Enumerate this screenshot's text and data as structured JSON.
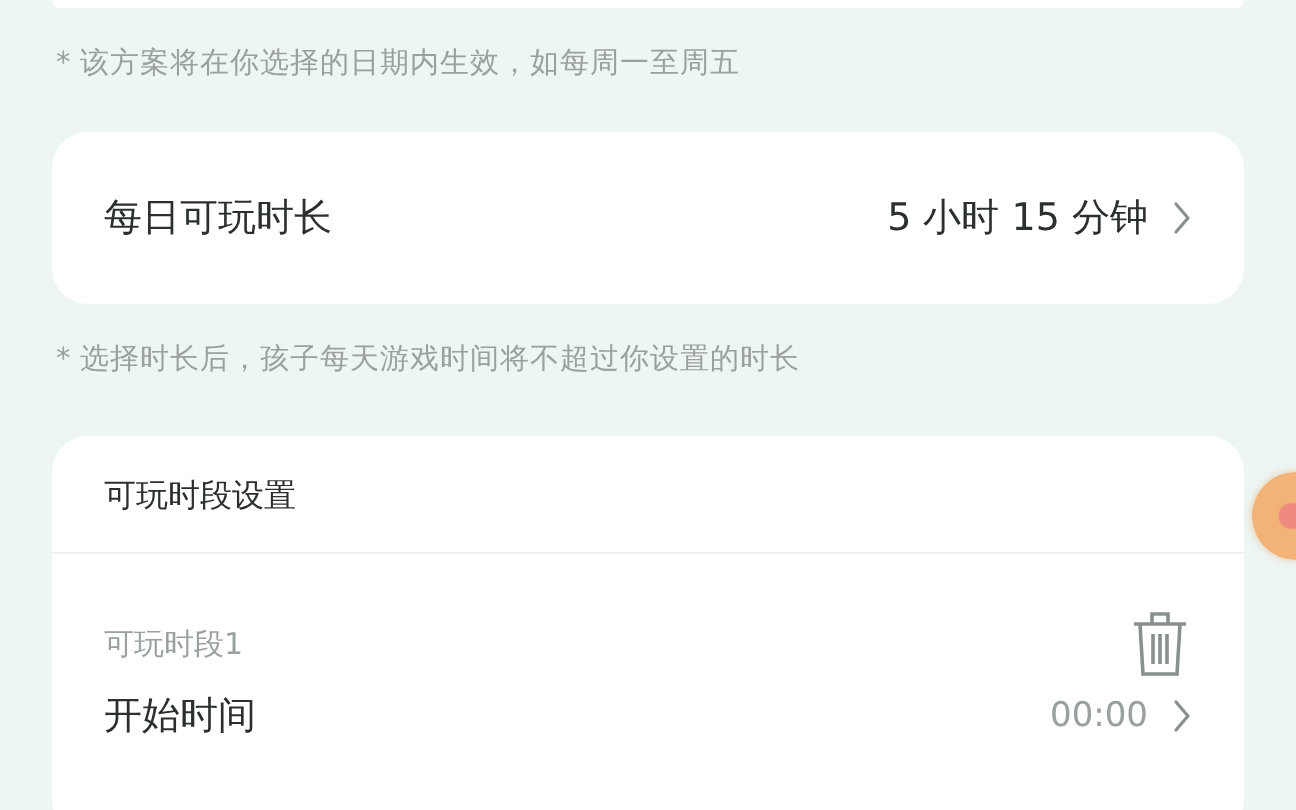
{
  "date_note": "* 该方案将在你选择的日期内生效，如每周一至周五",
  "daily_limit": {
    "label": "每日可玩时长",
    "value": "5 小时 15 分钟"
  },
  "limit_note": "* 选择时长后，孩子每天游戏时间将不超过你设置的时长",
  "periods_card": {
    "title": "可玩时段设置",
    "periods": [
      {
        "name": "可玩时段1",
        "rows": [
          {
            "label": "开始时间",
            "value": "00:00"
          }
        ]
      }
    ]
  }
}
